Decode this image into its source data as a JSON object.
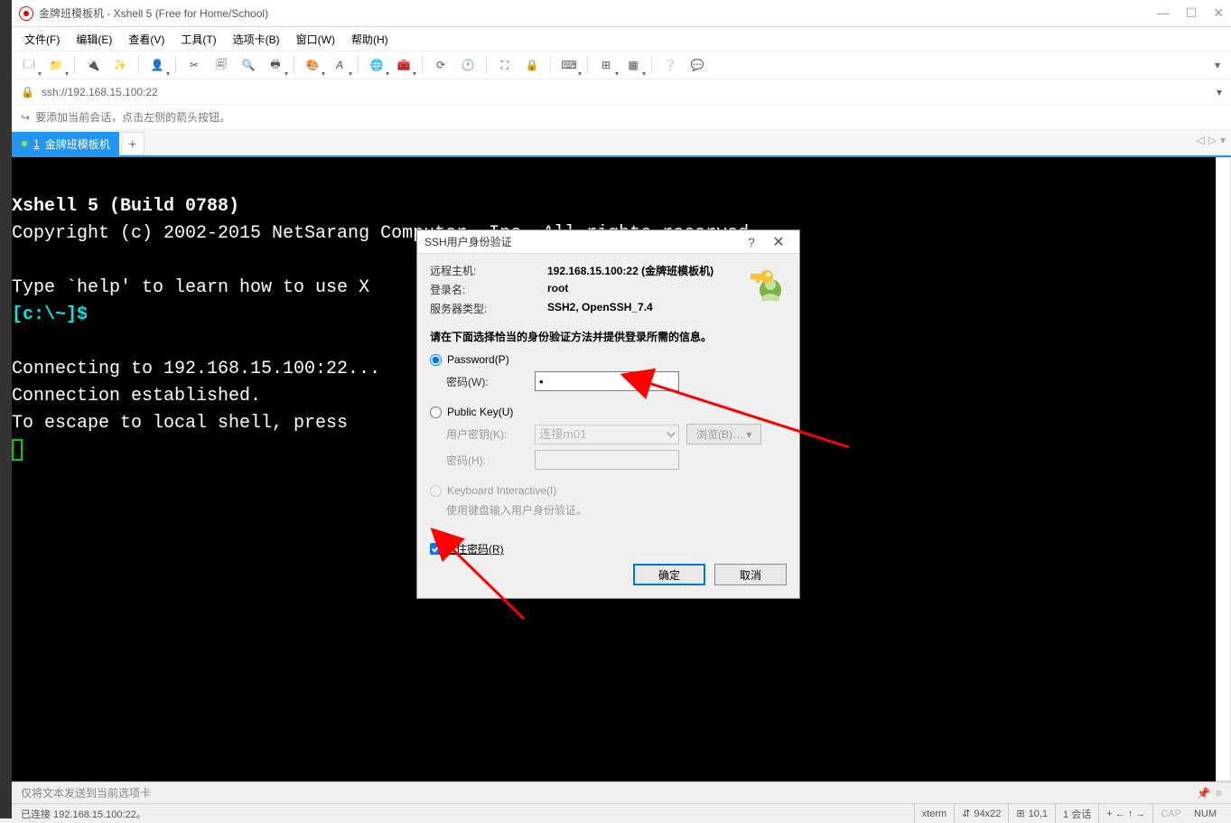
{
  "window": {
    "title": "金牌班模板机 - Xshell 5 (Free for Home/School)"
  },
  "menu": {
    "file": "文件(F)",
    "edit": "编辑(E)",
    "view": "查看(V)",
    "tools": "工具(T)",
    "tabs": "选项卡(B)",
    "window": "窗口(W)",
    "help": "帮助(H)"
  },
  "address": {
    "url": "ssh://192.168.15.100:22"
  },
  "hint": {
    "text": "要添加当前会话，点击左侧的箭头按钮。"
  },
  "tab": {
    "num": "1",
    "label": "金牌班模板机"
  },
  "terminal": {
    "l1": "Xshell 5 (Build 0788)",
    "l2": "Copyright (c) 2002-2015 NetSarang Computer, Inc. All rights reserved.",
    "l3": "",
    "l4a": "Type `help' to learn how to use X",
    "l5a": "[c:\\~]$",
    "l6": "",
    "l7": "Connecting to 192.168.15.100:22...",
    "l8": "Connection established.",
    "l9": "To escape to local shell, press "
  },
  "dialog": {
    "title": "SSH用户身份验证",
    "host_label": "远程主机:",
    "host_value": "192.168.15.100:22 (金牌班模板机)",
    "login_label": "登录名:",
    "login_value": "root",
    "server_label": "服务器类型:",
    "server_value": "SSH2, OpenSSH_7.4",
    "prompt": "请在下面选择恰当的身份验证方法并提供登录所需的信息。",
    "radio_password": "Password(P)",
    "password_label": "密码(W):",
    "password_value": "•",
    "radio_publickey": "Public Key(U)",
    "userkey_label": "用户密钥(K):",
    "userkey_value": "连接m01",
    "browse": "浏览(B)… ▾",
    "passphrase_label": "密码(H):",
    "radio_kbd": "Keyboard Interactive(I)",
    "kbd_text": "使用键盘输入用户身份验证。",
    "remember": "记住密码(R)",
    "ok": "确定",
    "cancel": "取消"
  },
  "bottombar": {
    "text": "仅将文本发送到当前选项卡"
  },
  "status": {
    "conn": "已连接 192.168.15.100:22。",
    "term": "xterm",
    "size": "94x22",
    "pos": "10,1",
    "sessions": "1 会话",
    "cap": "CAP",
    "num": "NUM"
  }
}
